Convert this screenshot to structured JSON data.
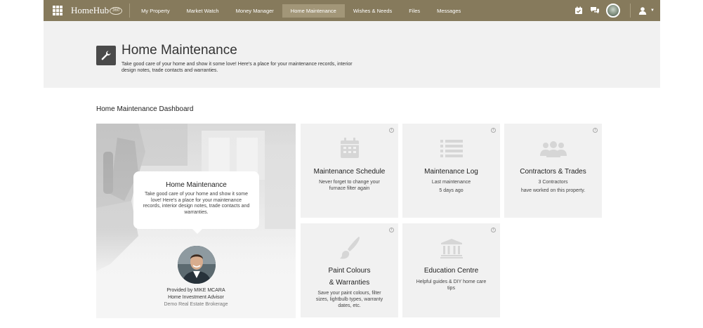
{
  "app": {
    "logo_text": "HomeHub",
    "logo_badge": "360"
  },
  "nav": {
    "items": [
      {
        "label": "My Property",
        "active": false
      },
      {
        "label": "Market Watch",
        "active": false
      },
      {
        "label": "Money Manager",
        "active": false
      },
      {
        "label": "Home Maintenance",
        "active": true
      },
      {
        "label": "Wishes & Needs",
        "active": false
      },
      {
        "label": "Files",
        "active": false
      },
      {
        "label": "Messages",
        "active": false
      }
    ],
    "right_icons": [
      "calendar-check-icon",
      "chat-icon",
      "user-avatar",
      "person-icon",
      "caret-down-icon"
    ]
  },
  "header": {
    "icon": "wrench-icon",
    "title": "Home Maintenance",
    "description": "Take good care of your home and show it some love! Here's a place for your maintenance records, interior design notes, trade contacts and warranties."
  },
  "dashboard": {
    "title": "Home Maintenance Dashboard",
    "hero": {
      "bubble_title": "Home Maintenance",
      "bubble_text": "Take good care of your home and show it some love! Here's a place for your maintenance records, interior design notes, trade contacts and warranties.",
      "provided_by": "Provided by MIKE MCARA",
      "role": "Home Investment Advisor",
      "brokerage": "Demo Real Estate Brokerage"
    },
    "tiles": [
      {
        "title": "Maintenance Schedule",
        "desc1": "Never forget to change your furnace filter again",
        "desc2": "",
        "icon": "calendar-icon"
      },
      {
        "title": "Maintenance Log",
        "desc1": "Last maintenance",
        "desc2": "5 days ago",
        "icon": "list-icon"
      },
      {
        "title": "Contractors & Trades",
        "desc1": "3 Contractors",
        "desc2": "have worked on this property.",
        "icon": "people-icon"
      },
      {
        "title": "Paint Colours",
        "title2": "& Warranties",
        "desc1": "Save your paint colours, filter sizes, lightbulb types, warranty dates, etc.",
        "icon": "paintbrush-icon"
      },
      {
        "title": "Education Centre",
        "desc1": "Helpful guides & DIY home care tips",
        "icon": "bank-icon"
      }
    ],
    "info_glyph": "i"
  },
  "colors": {
    "nav_bg": "#867a5c",
    "nav_active": "#a29678",
    "band_bg": "#f1f1f1",
    "tile_bg": "#f1f1f1",
    "tile_icon": "#d6d6d6"
  }
}
